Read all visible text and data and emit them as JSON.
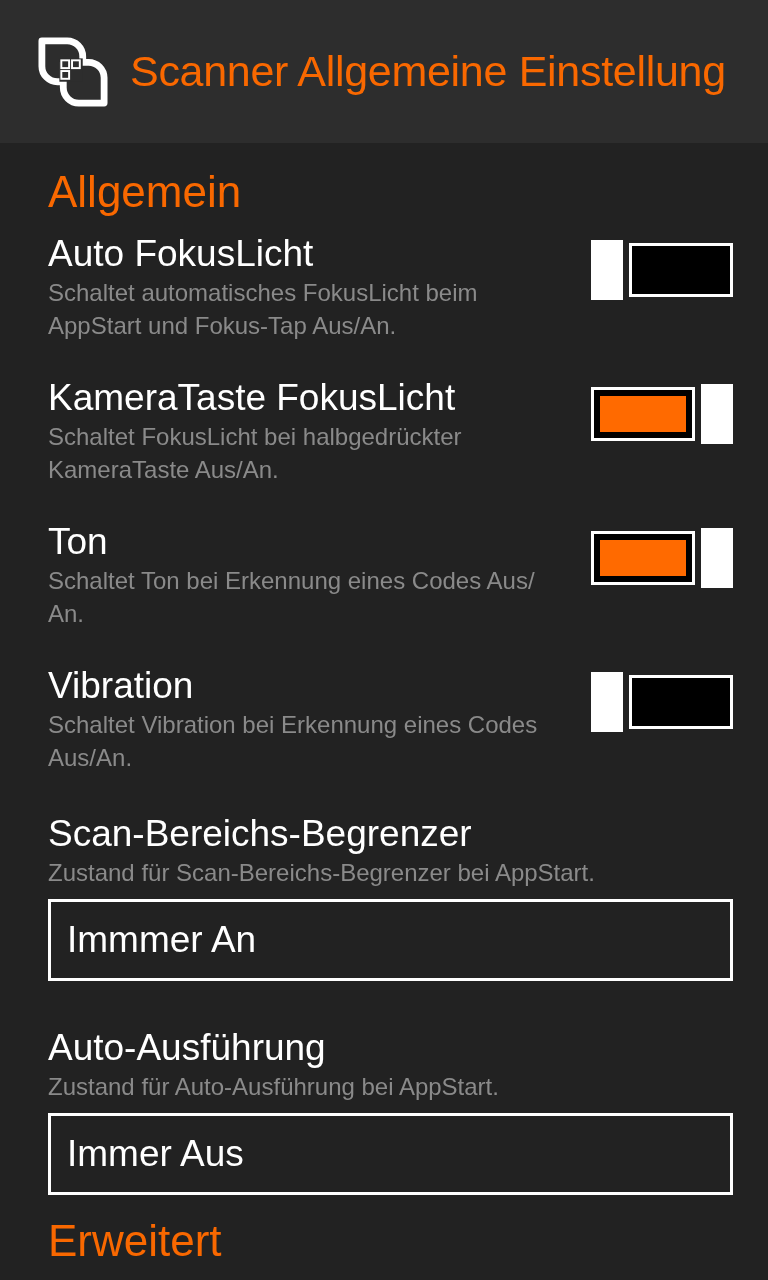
{
  "header": {
    "title": "Scanner Allgemeine Einstellung"
  },
  "sections": [
    {
      "title": "Allgemein",
      "settings": [
        {
          "kind": "toggle",
          "title": "Auto FokusLicht",
          "description": "Schaltet automatisches FokusLicht beim AppStart und Fokus-Tap Aus/An.",
          "on": false
        },
        {
          "kind": "toggle",
          "title": "KameraTaste FokusLicht",
          "description": "Schaltet FokusLicht bei halbgedrückter KameraTaste Aus/An.",
          "on": true
        },
        {
          "kind": "toggle",
          "title": "Ton",
          "description": "Schaltet Ton bei Erkennung eines Codes Aus/ An.",
          "on": true
        },
        {
          "kind": "toggle",
          "title": "Vibration",
          "description": "Schaltet Vibration bei Erkennung eines Codes Aus/An.",
          "on": false
        },
        {
          "kind": "dropdown",
          "title": "Scan-Bereichs-Begrenzer",
          "description": "Zustand für Scan-Bereichs-Begrenzer bei AppStart.",
          "value": "Immmer An"
        },
        {
          "kind": "dropdown",
          "title": "Auto-Ausführung",
          "description": "Zustand für Auto-Ausführung bei AppStart.",
          "value": "Immer Aus"
        }
      ]
    },
    {
      "title": "Erweitert"
    }
  ]
}
